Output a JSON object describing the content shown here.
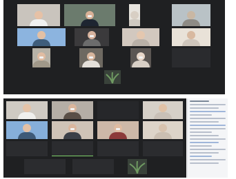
{
  "top_window": {
    "participants": [
      {
        "name": "",
        "masked": false,
        "skin": "#e6c1a6",
        "bg": "#c9c4bd",
        "shirt": "#f1f1f1"
      },
      {
        "name": "",
        "masked": true,
        "skin": "#d9b197",
        "bg": "#6b7b6d",
        "shirt": "#1e2531"
      },
      {
        "name": "",
        "masked": false,
        "skin": "#d8cfc4",
        "bg": "#e7e4de",
        "shirt": "#cfc9c1"
      },
      {
        "name": "",
        "masked": false,
        "skin": "#c9b7a3",
        "bg": "#b9c2c6",
        "shirt": "#8e8b85"
      },
      {
        "name": "",
        "masked": false,
        "skin": "#e3c0a4",
        "bg": "#8cb4df",
        "shirt": "#3f5d7b"
      },
      {
        "name": "",
        "masked": true,
        "skin": "#d6b29d",
        "bg": "#3b3a3c",
        "shirt": "#6c6c6c"
      },
      {
        "name": "",
        "masked": false,
        "skin": "#e4c7af",
        "bg": "#d2c8bf",
        "shirt": "#b9b0a7"
      },
      {
        "name": "",
        "masked": false,
        "skin": "#d8b9a0",
        "bg": "#e9e2d8",
        "shirt": "#cfc6bc"
      },
      {
        "name": "",
        "masked": true,
        "skin": "#e0bca2",
        "bg": "#b7b2a7",
        "shirt": "#a09889"
      },
      {
        "name": "",
        "masked": true,
        "skin": "#d7b59c",
        "bg": "#6e6961",
        "shirt": "#e4e0da"
      },
      {
        "name": "",
        "masked": true,
        "skin": "#e7d6c8",
        "bg": "#5b5653",
        "shirt": "#d8cfc6"
      },
      {
        "name": "",
        "masked": false,
        "skin": "",
        "bg": "#2a2b2e",
        "shirt": ""
      }
    ],
    "plant_color": "#6f9a62"
  },
  "bottom_window": {
    "participants": [
      {
        "name": "",
        "masked": false,
        "skin": "#e5c3a8",
        "bg": "#cfcac3",
        "shirt": "#f0efed"
      },
      {
        "name": "",
        "masked": true,
        "skin": "#d9b59c",
        "bg": "#b5aea6",
        "shirt": "#5a4f47"
      },
      {
        "name": "",
        "masked": false,
        "skin": "",
        "bg": "#26272a",
        "shirt": ""
      },
      {
        "name": "",
        "masked": false,
        "skin": "#e0c1a6",
        "bg": "#d6d0c8",
        "shirt": "#c9c0b7"
      },
      {
        "name": "",
        "masked": false,
        "skin": "#e3c0a5",
        "bg": "#86afda",
        "shirt": "#3e5a78"
      },
      {
        "name": "",
        "masked": true,
        "skin": "#dab69e",
        "bg": "#cfc3b7",
        "shirt": "#3c4048"
      },
      {
        "name": "",
        "masked": true,
        "skin": "#dfbba1",
        "bg": "#cdb8a8",
        "shirt": "#8c3a3a"
      },
      {
        "name": "",
        "masked": false,
        "skin": "#d7c2ae",
        "bg": "#ddd4c9",
        "shirt": "#cbbfb2"
      }
    ],
    "name_tiles": [
      "",
      "",
      "",
      ""
    ],
    "bottom_tiles": [
      "",
      ""
    ],
    "plant_color": "#6f9a62"
  },
  "chat": {
    "message_count": 9
  }
}
